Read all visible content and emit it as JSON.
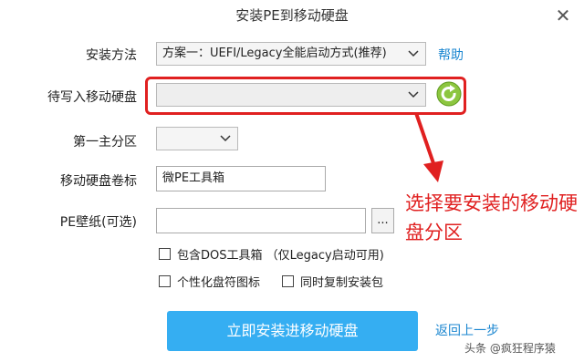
{
  "window": {
    "title": "安装PE到移动硬盘",
    "close_glyph": "✕"
  },
  "form": {
    "install_method_label": "安装方法",
    "install_method_value": "方案一：UEFI/Legacy全能启动方式(推荐)",
    "help_link": "帮助",
    "target_disk_label": "待写入移动硬盘",
    "target_disk_value": "",
    "first_partition_label": "第一主分区",
    "first_partition_value": "",
    "volume_label_label": "移动硬盘卷标",
    "volume_label_value": "微PE工具箱",
    "wallpaper_label": "PE壁纸(可选)",
    "wallpaper_value": "",
    "browse_label": "...",
    "dos_tools_label": "包含DOS工具箱 （仅Legacy启动可用)",
    "custom_icon_label": "个性化盘符图标",
    "copy_package_label": "同时复制安装包"
  },
  "actions": {
    "install_button": "立即安装进移动硬盘",
    "back_link": "返回上一步"
  },
  "annotation": {
    "text": "选择要安装的移动硬盘分区",
    "color": "#e02020"
  },
  "watermark": {
    "text": "头条 @疯狂程序猿"
  },
  "colors": {
    "accent": "#35aef2",
    "link": "#1a86d0",
    "refresh": "#8cc63f"
  }
}
